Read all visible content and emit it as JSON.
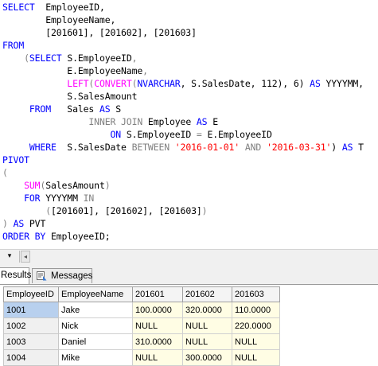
{
  "editor": {
    "lines": [
      {
        "tokens": [
          {
            "t": "SELECT",
            "c": "kw"
          },
          {
            "t": "  EmployeeID,",
            "c": ""
          }
        ]
      },
      {
        "tokens": [
          {
            "t": "        EmployeeName,",
            "c": ""
          }
        ]
      },
      {
        "tokens": [
          {
            "t": "        [201601], [201602], [201603]",
            "c": ""
          }
        ]
      },
      {
        "tokens": [
          {
            "t": "FROM",
            "c": "kw"
          }
        ]
      },
      {
        "tokens": [
          {
            "t": "    ",
            "c": ""
          },
          {
            "t": "(",
            "c": "gr"
          },
          {
            "t": "SELECT",
            "c": "kw"
          },
          {
            "t": " S.EmployeeID",
            "c": ""
          },
          {
            "t": ",",
            "c": "gr"
          }
        ]
      },
      {
        "tokens": [
          {
            "t": "            E.EmployeeName",
            "c": ""
          },
          {
            "t": ",",
            "c": "gr"
          }
        ]
      },
      {
        "tokens": [
          {
            "t": "            ",
            "c": ""
          },
          {
            "t": "LEFT",
            "c": "fn"
          },
          {
            "t": "(",
            "c": "gr"
          },
          {
            "t": "CONVERT",
            "c": "fn"
          },
          {
            "t": "(",
            "c": "gr"
          },
          {
            "t": "NVARCHAR",
            "c": "kw"
          },
          {
            "t": ", S.SalesDate, 112), 6) ",
            "c": ""
          },
          {
            "t": "AS",
            "c": "kw"
          },
          {
            "t": " YYYYMM,",
            "c": ""
          }
        ]
      },
      {
        "tokens": [
          {
            "t": "            S.SalesAmount",
            "c": ""
          }
        ]
      },
      {
        "tokens": [
          {
            "t": "     ",
            "c": ""
          },
          {
            "t": "FROM",
            "c": "kw"
          },
          {
            "t": "   Sales ",
            "c": ""
          },
          {
            "t": "AS",
            "c": "kw"
          },
          {
            "t": " S",
            "c": ""
          }
        ]
      },
      {
        "tokens": [
          {
            "t": "                ",
            "c": ""
          },
          {
            "t": "INNER JOIN",
            "c": "gr"
          },
          {
            "t": " Employee ",
            "c": ""
          },
          {
            "t": "AS",
            "c": "kw"
          },
          {
            "t": " E",
            "c": ""
          }
        ]
      },
      {
        "tokens": [
          {
            "t": "                    ",
            "c": ""
          },
          {
            "t": "ON",
            "c": "kw"
          },
          {
            "t": " S.EmployeeID ",
            "c": ""
          },
          {
            "t": "=",
            "c": "gr"
          },
          {
            "t": " E.EmployeeID",
            "c": ""
          }
        ]
      },
      {
        "tokens": [
          {
            "t": "     ",
            "c": ""
          },
          {
            "t": "WHERE",
            "c": "kw"
          },
          {
            "t": "  S.SalesDate ",
            "c": ""
          },
          {
            "t": "BETWEEN",
            "c": "gr"
          },
          {
            "t": " ",
            "c": ""
          },
          {
            "t": "'2016-01-01'",
            "c": "str"
          },
          {
            "t": " ",
            "c": ""
          },
          {
            "t": "AND",
            "c": "gr"
          },
          {
            "t": " ",
            "c": ""
          },
          {
            "t": "'2016-03-31'",
            "c": "str"
          },
          {
            "t": ") ",
            "c": ""
          },
          {
            "t": "AS",
            "c": "kw"
          },
          {
            "t": " T",
            "c": ""
          }
        ]
      },
      {
        "tokens": [
          {
            "t": "PIVOT",
            "c": "kw"
          }
        ]
      },
      {
        "tokens": [
          {
            "t": "(",
            "c": "gr"
          }
        ]
      },
      {
        "tokens": [
          {
            "t": "    ",
            "c": ""
          },
          {
            "t": "SUM",
            "c": "fn"
          },
          {
            "t": "(",
            "c": "gr"
          },
          {
            "t": "SalesAmount",
            "c": ""
          },
          {
            "t": ")",
            "c": "gr"
          }
        ]
      },
      {
        "tokens": [
          {
            "t": "    ",
            "c": ""
          },
          {
            "t": "FOR",
            "c": "kw"
          },
          {
            "t": " YYYYMM ",
            "c": ""
          },
          {
            "t": "IN",
            "c": "gr"
          }
        ]
      },
      {
        "tokens": [
          {
            "t": "        ",
            "c": ""
          },
          {
            "t": "(",
            "c": "gr"
          },
          {
            "t": "[201601], [201602], [201603]",
            "c": ""
          },
          {
            "t": ")",
            "c": "gr"
          }
        ]
      },
      {
        "tokens": [
          {
            "t": ") ",
            "c": "gr"
          },
          {
            "t": "AS",
            "c": "kw"
          },
          {
            "t": " PVT",
            "c": ""
          }
        ]
      },
      {
        "tokens": [
          {
            "t": "ORDER BY",
            "c": "kw"
          },
          {
            "t": " EmployeeID;",
            "c": ""
          }
        ]
      }
    ]
  },
  "scrollbar": {
    "zoom_symbol": "▾",
    "left_arrow": "◂"
  },
  "tabs": {
    "results": "Results",
    "messages": "Messages"
  },
  "results": {
    "columns": [
      "EmployeeID",
      "EmployeeName",
      "201601",
      "201602",
      "201603"
    ],
    "rows": [
      [
        "1001",
        "Jake",
        "100.0000",
        "320.0000",
        "110.0000"
      ],
      [
        "1002",
        "Nick",
        "NULL",
        "NULL",
        "220.0000"
      ],
      [
        "1003",
        "Daniel",
        "310.0000",
        "NULL",
        "NULL"
      ],
      [
        "1004",
        "Mike",
        "NULL",
        "300.0000",
        "NULL"
      ]
    ]
  }
}
